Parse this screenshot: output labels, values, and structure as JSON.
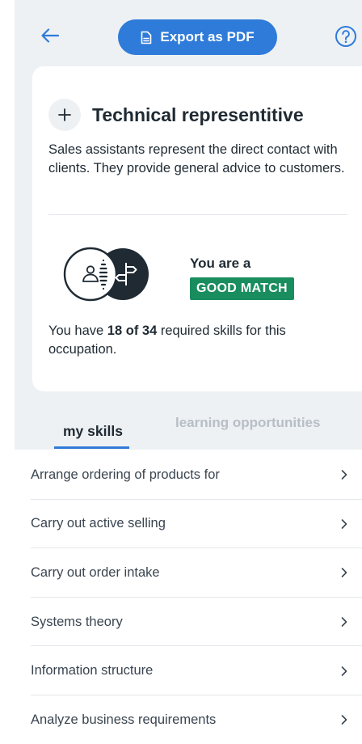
{
  "header": {
    "back_icon": "arrow-left-icon",
    "export_icon": "document-icon",
    "export_label": "Export as PDF",
    "help_icon": "question-circle-icon",
    "accent_color": "#2f7bd9"
  },
  "occupation": {
    "add_icon": "plus-icon",
    "title": "Technical representitive",
    "description": "Sales assistants represent the direct contact with clients. They provide general advice to customers.",
    "match_icon": "person-signpost-overlap-icon",
    "match_label": "You are a",
    "match_badge": "GOOD MATCH",
    "match_color": "#1a8d5f",
    "skills_have": 18,
    "skills_required": 34,
    "skills_prefix": "You have ",
    "skills_count_text": "18 of 34",
    "skills_suffix": " required skills for this occupation."
  },
  "tabs": [
    {
      "label": "my skills",
      "active": true
    },
    {
      "label": "learning opportunities",
      "active": false
    }
  ],
  "skills": [
    {
      "label": "Arrange ordering of products for"
    },
    {
      "label": "Carry out active selling"
    },
    {
      "label": "Carry out order intake"
    },
    {
      "label": "Systems theory"
    },
    {
      "label": "Information structure"
    },
    {
      "label": "Analyze business requirements"
    }
  ]
}
